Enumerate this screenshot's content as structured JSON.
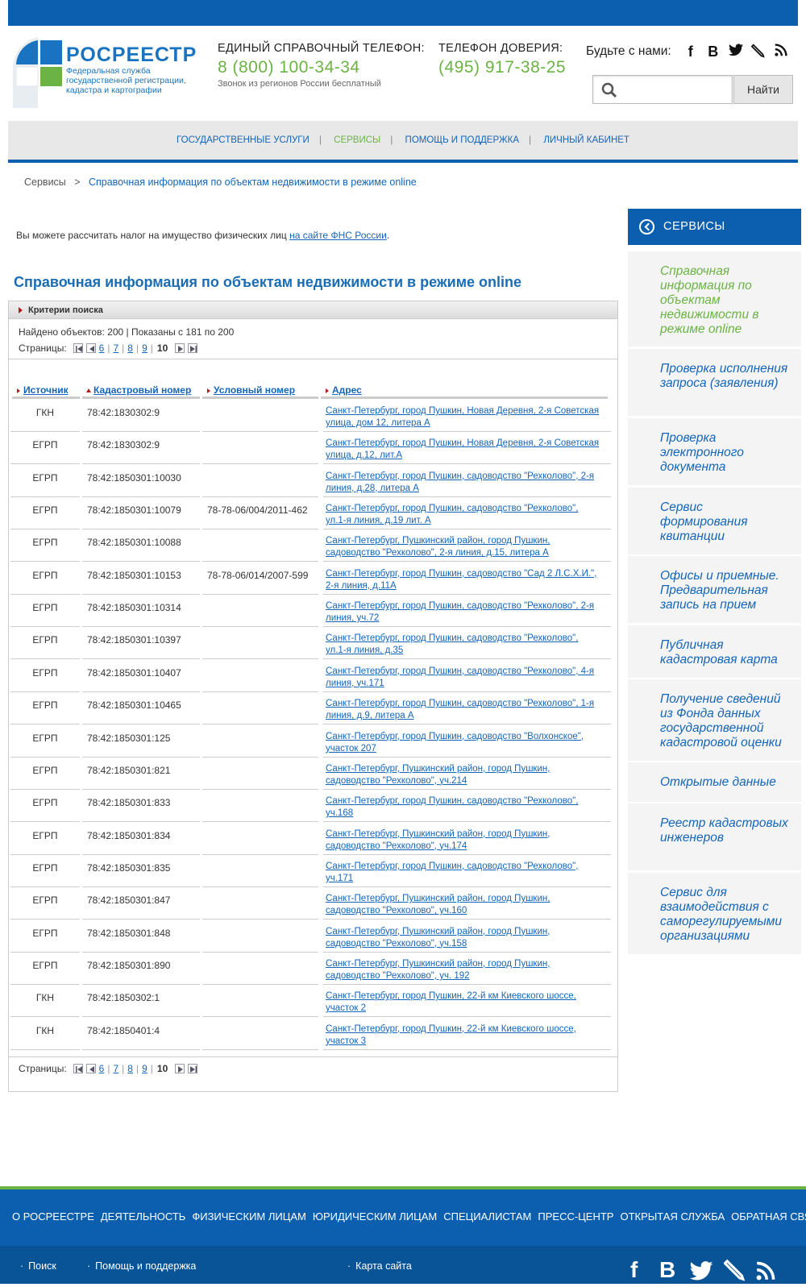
{
  "header": {
    "logo_title": "РОСРЕЕСТР",
    "logo_subtitle": "Федеральная служба государственной регистрации, кадастра и картографии",
    "hotline_label": "ЕДИНЫЙ СПРАВОЧНЫЙ ТЕЛЕФОН:",
    "hotline_number": "8 (800) 100-34-34",
    "hotline_note": "Звонок из регионов России бесплатный",
    "trust_label": "ТЕЛЕФОН ДОВЕРИЯ:",
    "trust_number": "(495) 917-38-25",
    "social_label": "Будьте с нами:",
    "search_button": "Найти",
    "search_placeholder": ""
  },
  "nav": {
    "items": [
      "ГОСУДАРСТВЕННЫЕ УСЛУГИ",
      "СЕРВИСЫ",
      "ПОМОЩЬ И ПОДДЕРЖКА",
      "ЛИЧНЫЙ КАБИНЕТ"
    ]
  },
  "breadcrumb": {
    "root": "Сервисы",
    "sep": ">",
    "current": "Справочная информация по объектам недвижимости в режиме online"
  },
  "notice": {
    "text": "Вы можете рассчитать налог на имущество физических лиц ",
    "link": "на сайте ФНС России",
    "end": "."
  },
  "page_title": "Справочная информация по объектам недвижимости в режиме online",
  "results": {
    "criteria_label": "Критерии поиска",
    "found_text": "Найдено объектов: 200 | Показаны с 181 по 200",
    "pages_label": "Страницы:",
    "pages": [
      "6",
      "7",
      "8",
      "9"
    ],
    "current_page": "10",
    "columns": [
      "Источник",
      "Кадастровый номер",
      "Условный номер",
      "Адрес"
    ],
    "rows": [
      {
        "src": "ГКН",
        "cad": "78:42:1830302:9",
        "cond": "",
        "addr": "Санкт-Петербург, город Пушкин, Новая Деревня, 2-я Советская улица, дом 12, литера А"
      },
      {
        "src": "ЕГРП",
        "cad": "78:42:1830302:9",
        "cond": "",
        "addr": "Санкт-Петербург, город Пушкин, Новая Деревня, 2-я Советская улица, д.12, лит.А"
      },
      {
        "src": "ЕГРП",
        "cad": "78:42:1850301:10030",
        "cond": "",
        "addr": "Санкт-Петербург, город Пушкин, садоводство \"Рехколово\", 2-я линия, д.28, литера А"
      },
      {
        "src": "ЕГРП",
        "cad": "78:42:1850301:10079",
        "cond": "78-78-06/004/2011-462",
        "addr": "Санкт-Петербург, город Пушкин, садоводство \"Рехколово\", ул.1-я линия, д.19 лит. А"
      },
      {
        "src": "ЕГРП",
        "cad": "78:42:1850301:10088",
        "cond": "",
        "addr": "Санкт-Петербург, Пушкинский район, город Пушкин, садоводство \"Рехколово\", 2-я линия, д.15, литера А"
      },
      {
        "src": "ЕГРП",
        "cad": "78:42:1850301:10153",
        "cond": "78-78-06/014/2007-599",
        "addr": "Санкт-Петербург, город Пушкин, садоводство \"Сад 2 Л.С.Х.И.\", 2-я линия, д.11А"
      },
      {
        "src": "ЕГРП",
        "cad": "78:42:1850301:10314",
        "cond": "",
        "addr": "Санкт-Петербург, город Пушкин, садоводство \"Рехколово\", 2-я линия, уч.72"
      },
      {
        "src": "ЕГРП",
        "cad": "78:42:1850301:10397",
        "cond": "",
        "addr": "Санкт-Петербург, город Пушкин, садоводство \"Рехколово\", ул.1-я линия, д.35"
      },
      {
        "src": "ЕГРП",
        "cad": "78:42:1850301:10407",
        "cond": "",
        "addr": "Санкт-Петербург, город Пушкин, садоводство \"Рехколово\", 4-я линия, уч.171"
      },
      {
        "src": "ЕГРП",
        "cad": "78:42:1850301:10465",
        "cond": "",
        "addr": "Санкт-Петербург, город Пушкин, садоводство \"Рехколово\", 1-я линия, д.9, литера А"
      },
      {
        "src": "ЕГРП",
        "cad": "78:42:1850301:125",
        "cond": "",
        "addr": "Санкт-Петербург, город Пушкин, садоводство \"Волхонское\", участок 207"
      },
      {
        "src": "ЕГРП",
        "cad": "78:42:1850301:821",
        "cond": "",
        "addr": "Санкт-Петербург, Пушкинский район, город Пушкин, садоводство \"Рехколово\", уч.214"
      },
      {
        "src": "ЕГРП",
        "cad": "78:42:1850301:833",
        "cond": "",
        "addr": "Санкт-Петербург, город Пушкин, садоводство \"Рехколово\", уч.168"
      },
      {
        "src": "ЕГРП",
        "cad": "78:42:1850301:834",
        "cond": "",
        "addr": "Санкт-Петербург, Пушкинский район, город Пушкин, садоводство \"Рехколово\", уч.174"
      },
      {
        "src": "ЕГРП",
        "cad": "78:42:1850301:835",
        "cond": "",
        "addr": "Санкт-Петербург, город Пушкин, садоводство \"Рехколово\", уч.171"
      },
      {
        "src": "ЕГРП",
        "cad": "78:42:1850301:847",
        "cond": "",
        "addr": "Санкт-Петербург, Пушкинский район, город Пушкин, садоводство \"Рехколово\", уч.160"
      },
      {
        "src": "ЕГРП",
        "cad": "78:42:1850301:848",
        "cond": "",
        "addr": "Санкт-Петербург, Пушкинский район, город Пушкин, садоводство \"Рехколово\", уч.158"
      },
      {
        "src": "ЕГРП",
        "cad": "78:42:1850301:890",
        "cond": "",
        "addr": "Санкт-Петербург, Пушкинский район, город Пушкин, садоводство \"Рехколово\", уч. 192"
      },
      {
        "src": "ГКН",
        "cad": "78:42:1850302:1",
        "cond": "",
        "addr": "Санкт-Петербург, город Пушкин, 22-й км Киевского шоссе, участок 2"
      },
      {
        "src": "ГКН",
        "cad": "78:42:1850401:4",
        "cond": "",
        "addr": "Санкт-Петербург, город Пушкин, 22-й км Киевского шоссе, участок 3"
      }
    ]
  },
  "sidebar": {
    "title": "СЕРВИСЫ",
    "items": [
      "Справочная информация по объектам недвижимости в режиме online",
      "Проверка исполнения запроса (заявления)",
      "Проверка электронного документа",
      "Сервис формирования квитанции",
      "Офисы и приемные. Предварительная запись на прием",
      "Публичная кадастровая карта",
      "Получение сведений из Фонда данных государственной кадастровой оценки",
      "Открытые данные",
      "Реестр кадастровых инженеров",
      "Сервис для взаимодействия с саморегулируемыми организациями"
    ]
  },
  "footer": {
    "nav": [
      "О РОСРЕЕСТРЕ",
      "ДЕЯТЕЛЬНОСТЬ",
      "ФИЗИЧЕСКИМ ЛИЦАМ",
      "ЮРИДИЧЕСКИМ ЛИЦАМ",
      "СПЕЦИАЛИСТАМ",
      "ПРЕСС-ЦЕНТР",
      "ОТКРЫТАЯ СЛУЖБА",
      "ОБРАТНАЯ СВЯЗЬ"
    ],
    "search": "Поиск",
    "help": "Помощь и поддержка",
    "sitemap": "Карта сайта"
  },
  "colors": {
    "brand_blue": "#0b5fae",
    "accent_green": "#6bb345",
    "link": "#1565b8"
  }
}
